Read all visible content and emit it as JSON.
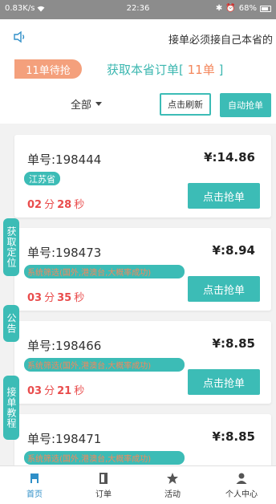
{
  "status_bar": {
    "speed": "0.83K/s",
    "time": "22:36",
    "battery": "68%"
  },
  "marquee": {
    "text": "接单必须接自己本省的"
  },
  "summary": {
    "pending_label": "11单待抢",
    "fetch_prefix": "获取本省订单[",
    "fetch_count": " 11单 ",
    "fetch_suffix": "]"
  },
  "toolbar": {
    "filter_label": "全部",
    "refresh_label": "点击刷新",
    "auto_label": "自动抢单"
  },
  "orders": [
    {
      "order_no": "单号:198444",
      "price": "¥:14.86",
      "tag": "江苏省",
      "minutes": "02",
      "seconds": "28",
      "button": "点击抢单"
    },
    {
      "order_no": "单号:198473",
      "price": "¥:8.94",
      "tag": "系统筛选(国外,港澳台,大概率成功)",
      "minutes": "03",
      "seconds": "35",
      "button": "点击抢单"
    },
    {
      "order_no": "单号:198466",
      "price": "¥:8.85",
      "tag": "系统筛选(国外,港澳台,大概率成功)",
      "minutes": "03",
      "seconds": "21",
      "button": "点击抢单"
    },
    {
      "order_no": "单号:198471",
      "price": "¥:8.85",
      "tag": "系统筛选(国外,港澳台,大概率成功)"
    }
  ],
  "units": {
    "min": "分",
    "sec": "秒"
  },
  "side_tabs": [
    "获取定位",
    "公告",
    "接单教程"
  ],
  "nav": [
    {
      "label": "首页",
      "icon": "home-icon"
    },
    {
      "label": "订单",
      "icon": "order-icon"
    },
    {
      "label": "活动",
      "icon": "star-icon"
    },
    {
      "label": "个人中心",
      "icon": "user-icon"
    }
  ],
  "colors": {
    "accent": "#3cbcb6",
    "badge": "#f4a07c",
    "highlight": "#f4875c",
    "timer": "#e94c4c",
    "nav_active": "#2f8fc8"
  }
}
